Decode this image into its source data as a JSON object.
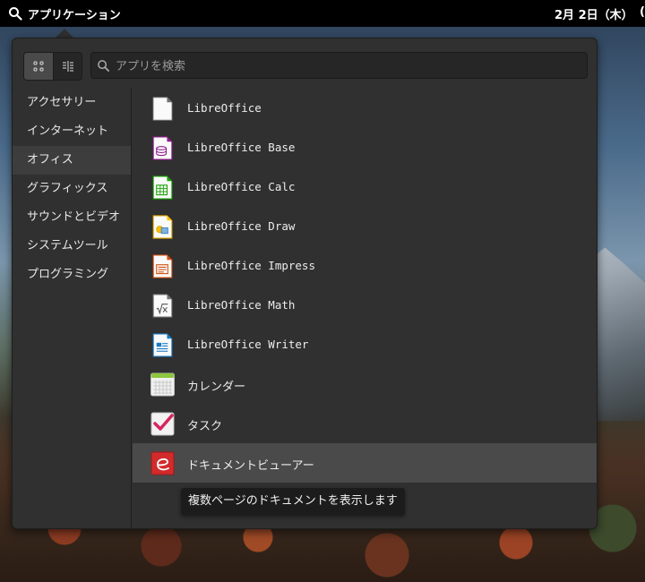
{
  "topbar": {
    "apps_label": "アプリケーション",
    "clock": "2月 2日（木）",
    "clock_overflow": "("
  },
  "search": {
    "placeholder": "アプリを検索"
  },
  "view_modes": [
    "grid-view",
    "category-view"
  ],
  "categories": [
    {
      "label": "アクセサリー",
      "selected": false
    },
    {
      "label": "インターネット",
      "selected": false
    },
    {
      "label": "オフィス",
      "selected": true
    },
    {
      "label": "グラフィックス",
      "selected": false
    },
    {
      "label": "サウンドとビデオ",
      "selected": false
    },
    {
      "label": "システムツール",
      "selected": false
    },
    {
      "label": "プログラミング",
      "selected": false
    }
  ],
  "apps": [
    {
      "label": "LibreOffice",
      "icon": "libreoffice-icon"
    },
    {
      "label": "LibreOffice Base",
      "icon": "libreoffice-base-icon"
    },
    {
      "label": "LibreOffice Calc",
      "icon": "libreoffice-calc-icon"
    },
    {
      "label": "LibreOffice Draw",
      "icon": "libreoffice-draw-icon"
    },
    {
      "label": "LibreOffice Impress",
      "icon": "libreoffice-impress-icon"
    },
    {
      "label": "LibreOffice Math",
      "icon": "libreoffice-math-icon"
    },
    {
      "label": "LibreOffice Writer",
      "icon": "libreoffice-writer-icon"
    },
    {
      "label": "カレンダー",
      "icon": "calendar-icon"
    },
    {
      "label": "タスク",
      "icon": "tasks-icon"
    },
    {
      "label": "ドキュメントビューアー",
      "icon": "document-viewer-icon"
    }
  ],
  "tooltip": "複数ページのドキュメントを表示します",
  "colors": {
    "menu_bg": "#303030",
    "base": "#8e1d8c",
    "calc": "#18a303",
    "draw": "#ffc000",
    "impress": "#d24d0d",
    "math": "#737373",
    "writer": "#1a7ac3",
    "calendar_top": "#8dc63f",
    "tasks_check": "#d7245d",
    "viewer": "#d22b2b"
  }
}
